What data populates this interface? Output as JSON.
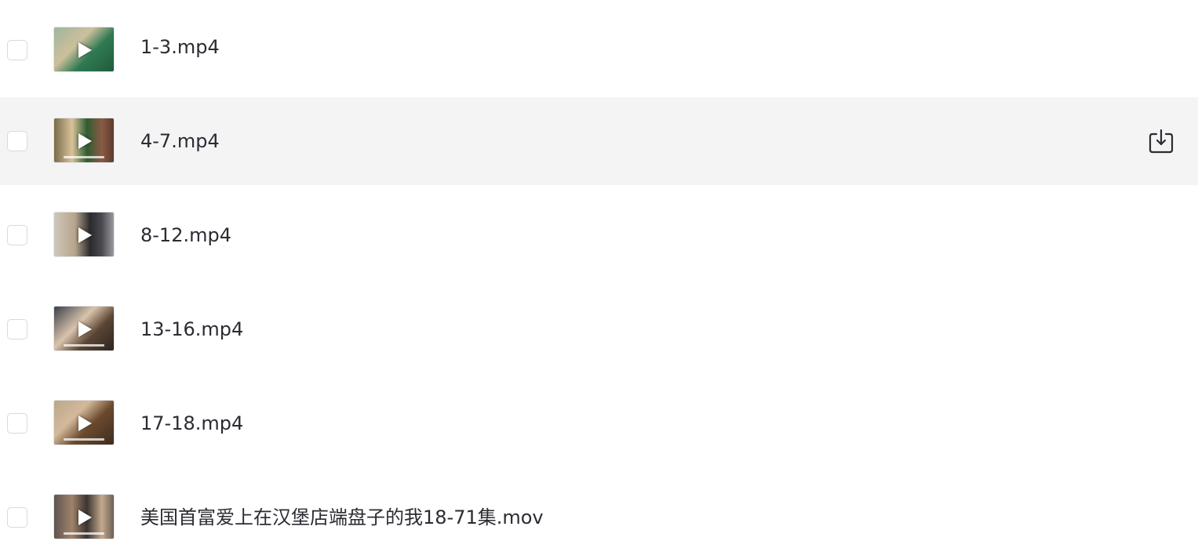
{
  "files": [
    {
      "name": "1-3.mp4",
      "type": "video"
    },
    {
      "name": "4-7.mp4",
      "type": "video",
      "hovered": true,
      "action_icon": "download-icon"
    },
    {
      "name": "8-12.mp4",
      "type": "video"
    },
    {
      "name": "13-16.mp4",
      "type": "video"
    },
    {
      "name": "17-18.mp4",
      "type": "video"
    },
    {
      "name": "美国首富爱上在汉堡店端盘子的我18-71集.mov",
      "type": "video"
    }
  ],
  "colors": {
    "hover_row_background": "#f4f4f5",
    "text": "#2b2b33",
    "checkbox_border": "#d9d9df"
  },
  "icons": {
    "thumbnail_overlay": "play-icon",
    "row_action": "download-icon"
  }
}
